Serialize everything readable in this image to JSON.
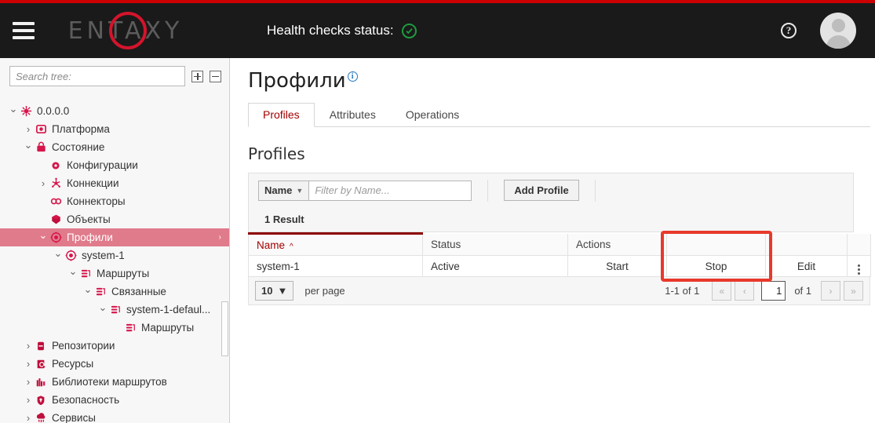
{
  "header": {
    "menu_icon": "hamburger-icon",
    "logo_text": "ENTAXY",
    "health_label": "Health checks status:",
    "health_icon": "check-circle-icon",
    "help_icon": "help-circle-icon",
    "help_glyph": "?",
    "avatar_icon": "user-avatar-icon",
    "accent_red": "#cc0000",
    "health_green": "#1f9b3e"
  },
  "sidebar": {
    "search_placeholder": "Search tree:",
    "search_value": "",
    "expand_all_icon": "expand-all-icon",
    "collapse_all_icon": "collapse-all-icon",
    "selected_bg": "#e07b8b",
    "tree": [
      {
        "label": "0.0.0.0",
        "depth": 0,
        "caret": "v",
        "icon": "node-icon",
        "selected": false
      },
      {
        "label": "Платформа",
        "depth": 1,
        "caret": ">",
        "icon": "platform-icon",
        "selected": false
      },
      {
        "label": "Состояние",
        "depth": 1,
        "caret": "v",
        "icon": "state-icon",
        "selected": false
      },
      {
        "label": "Конфигурации",
        "depth": 2,
        "caret": "",
        "icon": "gear-icon",
        "selected": false
      },
      {
        "label": "Коннекции",
        "depth": 2,
        "caret": ">",
        "icon": "connections-icon",
        "selected": false
      },
      {
        "label": "Коннекторы",
        "depth": 2,
        "caret": "",
        "icon": "connectors-icon",
        "selected": false
      },
      {
        "label": "Объекты",
        "depth": 2,
        "caret": "",
        "icon": "objects-icon",
        "selected": false
      },
      {
        "label": "Профили",
        "depth": 2,
        "caret": "v",
        "icon": "profiles-icon",
        "selected": true
      },
      {
        "label": "system-1",
        "depth": 3,
        "caret": "v",
        "icon": "profiles-icon",
        "selected": false
      },
      {
        "label": "Маршруты",
        "depth": 4,
        "caret": "v",
        "icon": "routes-icon",
        "selected": false
      },
      {
        "label": "Связанные",
        "depth": 5,
        "caret": "v",
        "icon": "routes-icon",
        "selected": false
      },
      {
        "label": "system-1-defaul...",
        "depth": 6,
        "caret": "v",
        "icon": "routes-icon",
        "selected": false
      },
      {
        "label": "Маршруты",
        "depth": 7,
        "caret": "",
        "icon": "routes-icon",
        "selected": false
      },
      {
        "label": "Репозитории",
        "depth": 1,
        "caret": ">",
        "icon": "repository-icon",
        "selected": false
      },
      {
        "label": "Ресурсы",
        "depth": 1,
        "caret": ">",
        "icon": "resources-icon",
        "selected": false
      },
      {
        "label": "Библиотеки маршрутов",
        "depth": 1,
        "caret": ">",
        "icon": "libraries-icon",
        "selected": false
      },
      {
        "label": "Безопасность",
        "depth": 1,
        "caret": ">",
        "icon": "shield-icon",
        "selected": false
      },
      {
        "label": "Сервисы",
        "depth": 1,
        "caret": ">",
        "icon": "services-icon",
        "selected": false
      }
    ]
  },
  "main": {
    "page_title": "Профили",
    "page_info_icon": "info-icon",
    "tabs": [
      {
        "label": "Profiles",
        "active": true
      },
      {
        "label": "Attributes",
        "active": false
      },
      {
        "label": "Operations",
        "active": false
      }
    ],
    "section_title": "Profiles",
    "toolbar": {
      "filter_field": "Name",
      "filter_chevron_icon": "chevron-down-icon",
      "filter_placeholder": "Filter by Name...",
      "filter_value": "",
      "add_profile_label": "Add Profile"
    },
    "result_count": "1 Result",
    "table": {
      "columns": [
        {
          "label": "Name",
          "sorted": true,
          "sort_icon": "sort-asc-icon"
        },
        {
          "label": "Status",
          "sorted": false,
          "sort_icon": ""
        },
        {
          "label": "Actions",
          "sorted": false,
          "sort_icon": ""
        },
        {
          "label": "",
          "sorted": false,
          "sort_icon": ""
        },
        {
          "label": "",
          "sorted": false,
          "sort_icon": ""
        },
        {
          "label": "",
          "sorted": false,
          "sort_icon": ""
        }
      ],
      "rows": [
        {
          "name": "system-1",
          "status": "Active",
          "actions": [
            "Start",
            "Stop",
            "Edit"
          ],
          "kebab_icon": "more-vertical-icon"
        }
      ]
    },
    "pagination": {
      "per_page_value": "10",
      "per_page_chevron_icon": "chevron-down-icon",
      "per_page_label": "per page",
      "range": "1-1 of 1",
      "first_icon": "«",
      "prev_icon": "‹",
      "page_value": "1",
      "of_label": "of 1",
      "next_icon": "›",
      "last_icon": "»"
    }
  },
  "annotation": {
    "target": "stop-action-cell",
    "color": "#e8392b"
  }
}
